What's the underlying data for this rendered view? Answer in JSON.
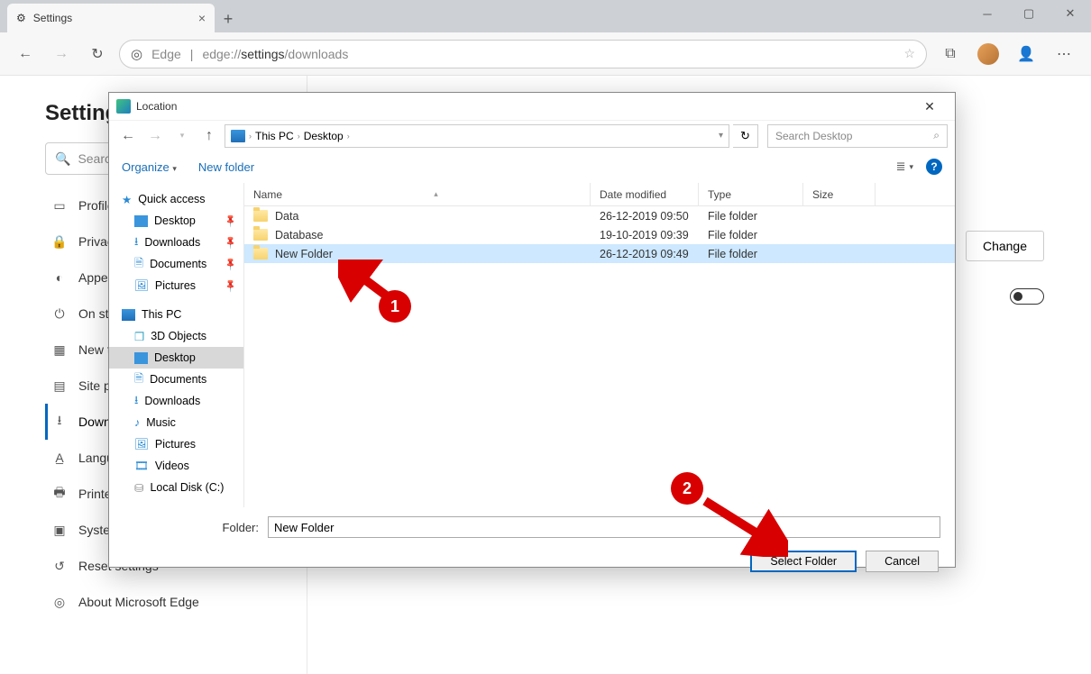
{
  "tab": {
    "title": "Settings"
  },
  "address": {
    "prefix": "Edge",
    "url_gray_pre": "edge://",
    "url_dark": "settings",
    "url_gray_post": "/downloads"
  },
  "settings": {
    "heading": "Settings",
    "search_placeholder": "Search settings",
    "items": [
      {
        "label": "Profiles"
      },
      {
        "label": "Privacy and services"
      },
      {
        "label": "Appearance"
      },
      {
        "label": "On startup"
      },
      {
        "label": "New tab page"
      },
      {
        "label": "Site permissions"
      },
      {
        "label": "Downloads"
      },
      {
        "label": "Languages"
      },
      {
        "label": "Printers"
      },
      {
        "label": "System"
      },
      {
        "label": "Reset settings"
      },
      {
        "label": "About Microsoft Edge"
      }
    ],
    "change_btn": "Change"
  },
  "dialog": {
    "title": "Location",
    "breadcrumb": [
      "This PC",
      "Desktop"
    ],
    "search_placeholder": "Search Desktop",
    "toolbar": {
      "organize": "Organize",
      "new_folder": "New folder"
    },
    "columns": {
      "name": "Name",
      "date": "Date modified",
      "type": "Type",
      "size": "Size"
    },
    "tree": {
      "quick": "Quick access",
      "quick_items": [
        "Desktop",
        "Downloads",
        "Documents",
        "Pictures"
      ],
      "thispc": "This PC",
      "pc_items": [
        "3D Objects",
        "Desktop",
        "Documents",
        "Downloads",
        "Music",
        "Pictures",
        "Videos",
        "Local Disk (C:)"
      ]
    },
    "files": [
      {
        "name": "Data",
        "date": "26-12-2019 09:50",
        "type": "File folder"
      },
      {
        "name": "Database",
        "date": "19-10-2019 09:39",
        "type": "File folder"
      },
      {
        "name": "New Folder",
        "date": "26-12-2019 09:49",
        "type": "File folder"
      }
    ],
    "folder_label": "Folder:",
    "folder_value": "New Folder",
    "select_btn": "Select Folder",
    "cancel_btn": "Cancel"
  },
  "anno": {
    "one": "1",
    "two": "2"
  }
}
